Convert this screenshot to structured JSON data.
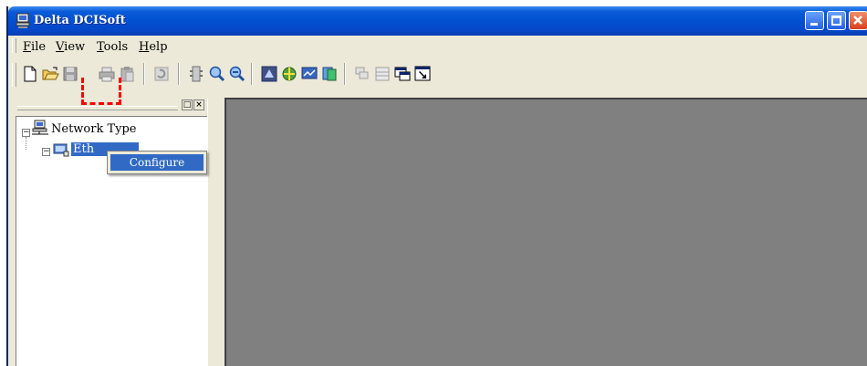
{
  "window": {
    "title": "Delta DCISoft"
  },
  "menu": {
    "items": [
      {
        "pre": "",
        "u": "F",
        "post": "ile"
      },
      {
        "pre": "",
        "u": "V",
        "post": "iew"
      },
      {
        "pre": "",
        "u": "T",
        "post": "ools"
      },
      {
        "pre": "",
        "u": "H",
        "post": "elp"
      }
    ]
  },
  "toolbar": {
    "buttons": [
      "new-icon",
      "open-icon",
      "save-icon",
      "print-icon",
      "paste-icon",
      "refresh-icon",
      "search-device-icon",
      "zoom-icon",
      "find-icon",
      "settings-icon",
      "network-icon",
      "monitor-icon",
      "database-icon",
      "cascade-icon",
      "tile-icon",
      "window-icon",
      "help-icon"
    ]
  },
  "tree": {
    "root_label": "Network Type",
    "child_label": "Eth"
  },
  "context_menu": {
    "item": "Configure"
  },
  "colors": {
    "title_blue": "#0250d0",
    "selection": "#316ac5",
    "workspace": "#808080",
    "highlight": "#ff0000"
  }
}
